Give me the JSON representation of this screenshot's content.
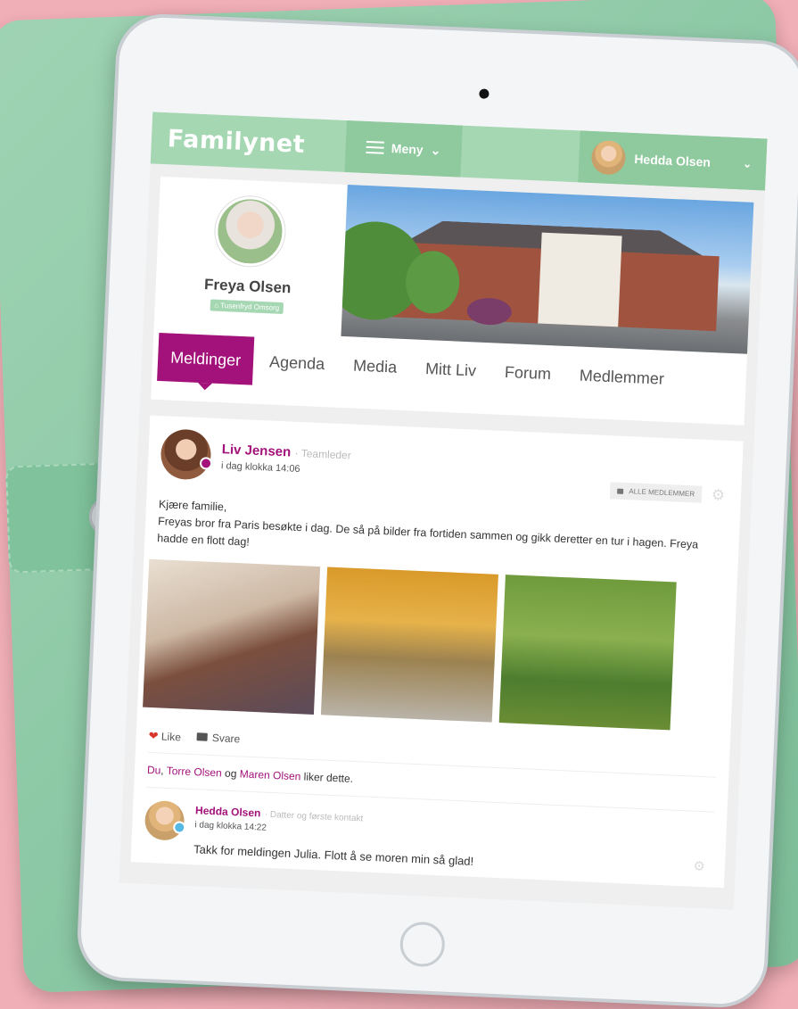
{
  "colors": {
    "brand_green": "#a6d7b3",
    "accent_magenta": "#a3127a",
    "online_dot": "#a3127a",
    "reply_dot": "#55b9e6"
  },
  "header": {
    "logo": "Familynet",
    "menu_label": "Meny",
    "user_name": "Hedda Olsen"
  },
  "profile": {
    "name": "Freya Olsen",
    "badge": "Tusenfryd Omsorg"
  },
  "tabs": [
    "Meldinger",
    "Agenda",
    "Media",
    "Mitt Liv",
    "Forum",
    "Medlemmer"
  ],
  "post": {
    "author": "Liv Jensen",
    "role": "Teamleder",
    "time": "i dag klokka 14:06",
    "visibility": "ALLE MEDLEMMER",
    "text_line1": "Kjære familie,",
    "text_line2": "Freyas bror fra Paris besøkte i dag. De så på bilder fra fortiden sammen og gikk deretter en tur i hagen. Freya hadde en flott dag!",
    "like_label": "Like",
    "reply_label": "Svare",
    "likes": {
      "who1": "Du",
      "sep1": ", ",
      "who2": "Torre Olsen",
      "sep2": " og ",
      "who3": "Maren Olsen",
      "suffix": " liker dette."
    }
  },
  "reply": {
    "author": "Hedda Olsen",
    "role": "Datter og første kontakt",
    "time": "i dag klokka 14:22",
    "text": "Takk for meldingen Julia. Flott å se moren min så glad!"
  }
}
